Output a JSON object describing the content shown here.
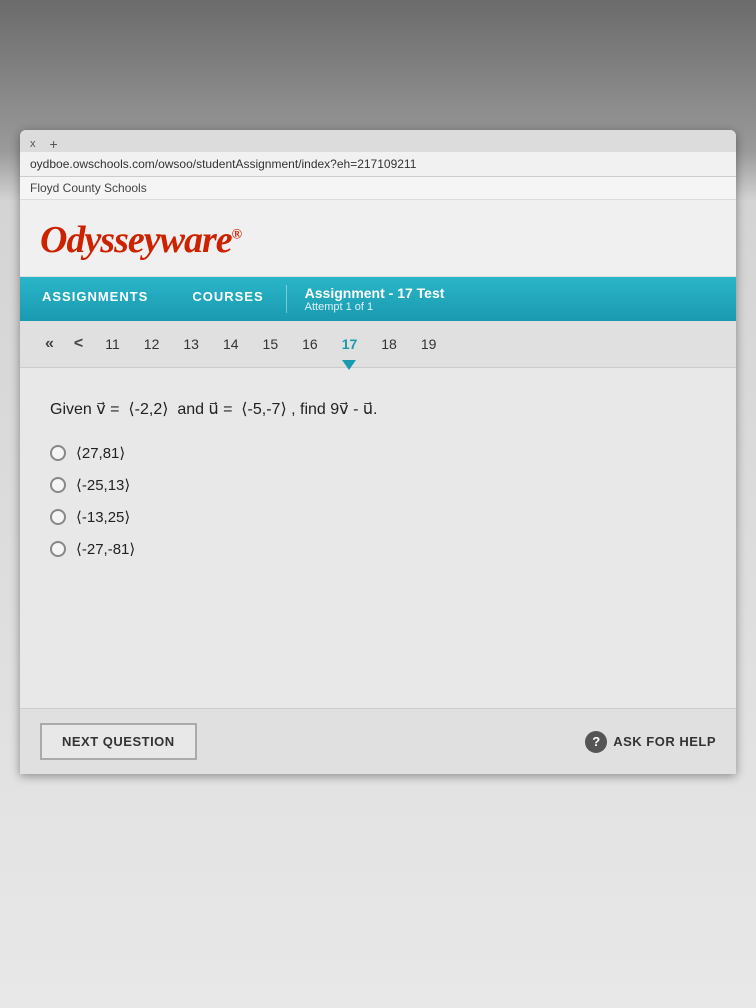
{
  "browser": {
    "tab_close": "x",
    "tab_new": "+",
    "address": "oydboe.owschools.com/owsoo/studentAssignment/index?eh=217109211",
    "bookmark": "Floyd County Schools"
  },
  "header": {
    "logo": "Odysseyware",
    "logo_symbol": "®"
  },
  "nav": {
    "assignments_label": "ASSIGNMENTS",
    "courses_label": "COURSES",
    "assignment_title": "Assignment  - 17  Test",
    "assignment_attempt": "Attempt 1 of 1"
  },
  "pagination": {
    "first": "«",
    "prev": "<",
    "pages": [
      "11",
      "12",
      "13",
      "14",
      "15",
      "16",
      "17",
      "18",
      "19"
    ],
    "active_page": "17"
  },
  "question": {
    "text_parts": {
      "given": "Given",
      "v_vec": "v",
      "v_val": "⟨-2,2⟩",
      "and": "and",
      "u_vec": "u",
      "u_val": "⟨-5,-7⟩",
      "find": ", find 9",
      "v_vec2": "v",
      "minus": " - ",
      "u_vec2": "u",
      "period": "."
    },
    "full_text": "Given v⃗ = ⟨-2,2⟩  and u⃗ = ⟨-5,-7⟩ , find 9v⃗ - u⃗.",
    "options": [
      {
        "id": "a",
        "text": "⟨27,81⟩"
      },
      {
        "id": "b",
        "text": "⟨-25,13⟩"
      },
      {
        "id": "c",
        "text": "⟨-13,25⟩"
      },
      {
        "id": "d",
        "text": "⟨-27,-81⟩"
      }
    ]
  },
  "footer": {
    "next_question_label": "NEXT QUESTION",
    "ask_for_help_label": "ASK FOR HELP",
    "help_icon": "?"
  },
  "colors": {
    "accent": "#1a9ab0",
    "logo_red": "#cc2200",
    "nav_bg": "#2ab5c8"
  }
}
